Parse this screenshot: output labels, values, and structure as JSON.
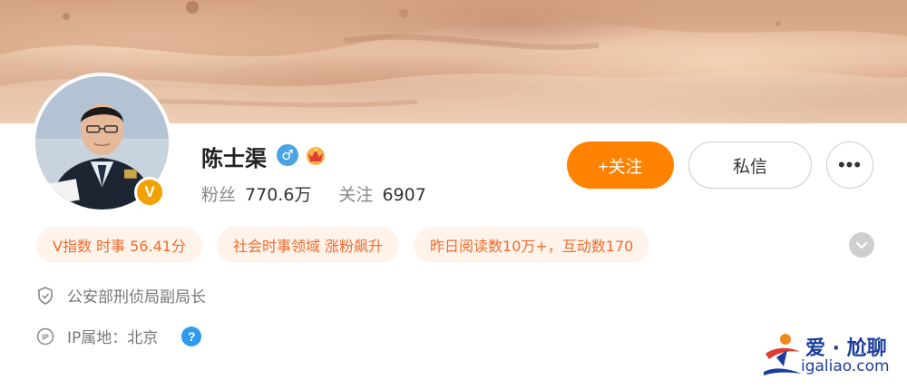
{
  "profile": {
    "name": "陈士渠",
    "verified_badge": "V",
    "gender_icon": "male-symbol-icon",
    "fans_label": "粉丝",
    "fans_value": "770.6万",
    "following_label": "关注",
    "following_value": "6907"
  },
  "actions": {
    "follow_label": "+关注",
    "message_label": "私信",
    "more_label": "•••"
  },
  "tags": [
    "V指数 时事 56.41分",
    "社会时事领域 涨粉飙升",
    "昨日阅读数10万+，互动数170"
  ],
  "info": {
    "title": "公安部刑侦局副局长",
    "ip_label": "IP属地：北京"
  },
  "watermark": {
    "brand": "爱 · 尬聊",
    "url": "igaliao.com"
  },
  "colors": {
    "accent": "#ff8200",
    "tag_bg": "#fff3ea",
    "tag_text": "#f26b2d",
    "verified": "#f2a100",
    "help": "#2f9bf0"
  }
}
